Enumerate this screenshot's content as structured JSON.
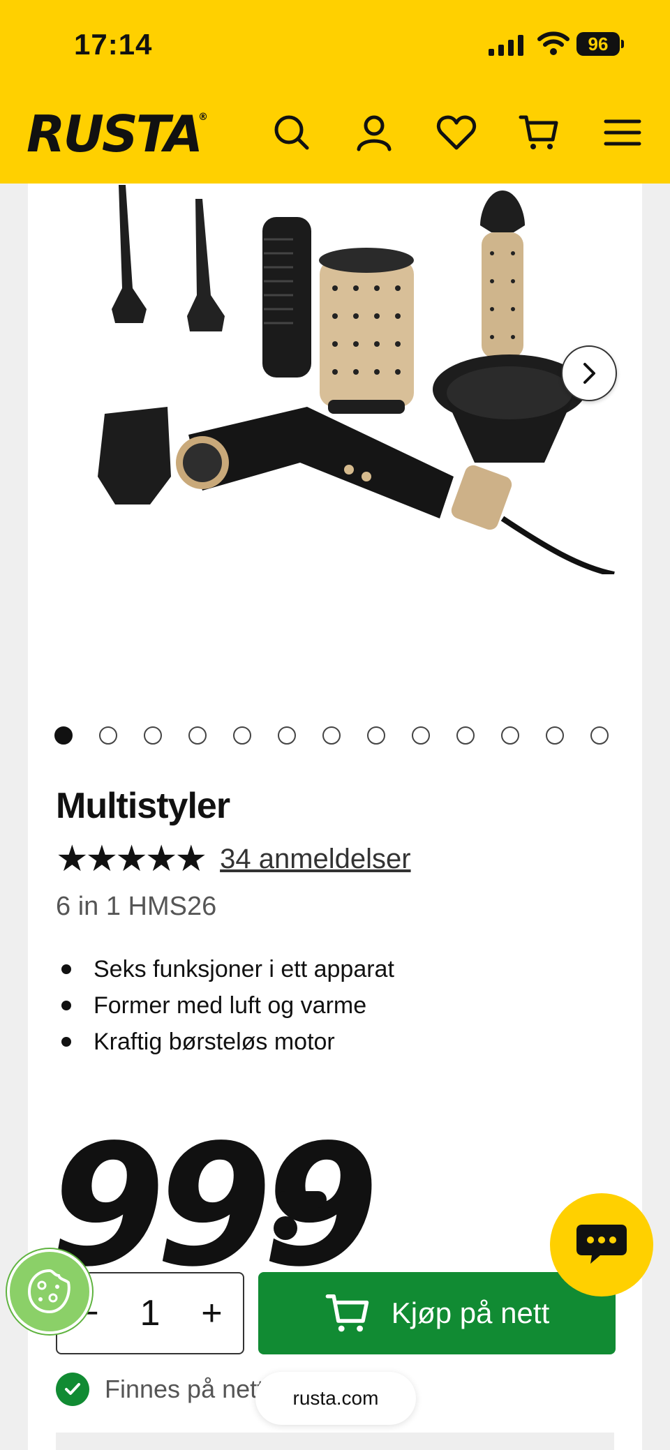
{
  "status_bar": {
    "time": "17:14",
    "battery": "96"
  },
  "header": {
    "logo": "RUSTA",
    "logo_mark": "®",
    "icons": [
      "search-icon",
      "account-icon",
      "heart-icon",
      "cart-icon",
      "menu-icon"
    ]
  },
  "gallery": {
    "total_images": 13,
    "active_index": 0
  },
  "product": {
    "title": "Multistyler",
    "stars": "★★★★★",
    "rating": 5,
    "reviews_label": "34 anmeldelser",
    "subtitle": "6 in 1 HMS26",
    "bullets": [
      "Seks funksjoner i ett apparat",
      "Former med luft og varme",
      "Kraftig børsteløs motor"
    ],
    "price": "999"
  },
  "purchase": {
    "minus": "−",
    "quantity": "1",
    "plus": "+",
    "buy_label": "Kjøp på nett"
  },
  "stock": {
    "label": "Finnes på nett"
  },
  "browser": {
    "url": "rusta.com"
  },
  "colors": {
    "brand_yellow": "#ffd000",
    "buy_green": "#118b33",
    "cookie_green": "#8bd068"
  }
}
